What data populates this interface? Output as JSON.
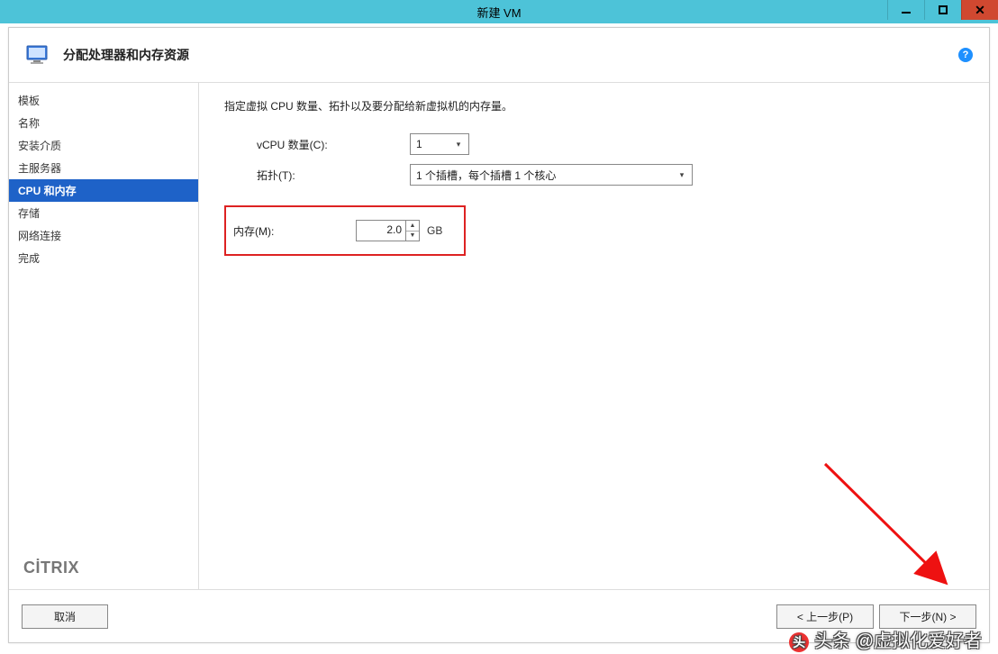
{
  "window": {
    "title": "新建 VM"
  },
  "header": {
    "title": "分配处理器和内存资源"
  },
  "sidebar": {
    "items": [
      {
        "label": "模板"
      },
      {
        "label": "名称"
      },
      {
        "label": "安装介质"
      },
      {
        "label": "主服务器"
      },
      {
        "label": "CPU 和内存"
      },
      {
        "label": "存储"
      },
      {
        "label": "网络连接"
      },
      {
        "label": "完成"
      }
    ],
    "active_index": 4,
    "brand": "CİTRIX"
  },
  "content": {
    "description": "指定虚拟 CPU 数量、拓扑以及要分配给新虚拟机的内存量。",
    "vcpu_label": "vCPU 数量(C):",
    "vcpu_value": "1",
    "topology_label": "拓扑(T):",
    "topology_value": "1 个插槽，每个插槽 1 个核心",
    "memory_label": "内存(M):",
    "memory_value": "2.0",
    "memory_unit": "GB"
  },
  "footer": {
    "cancel": "取消",
    "prev": "< 上一步(P)",
    "next": "下一步(N) >"
  },
  "watermark": {
    "text": "头条 @虚拟化爱好者"
  }
}
